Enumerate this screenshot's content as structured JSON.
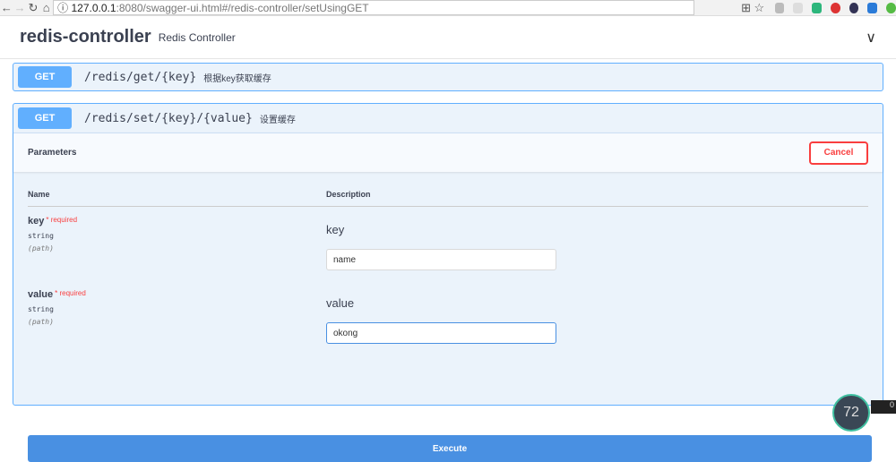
{
  "browser": {
    "url_host": "127.0.0.1",
    "url_path": ":8080/swagger-ui.html#/redis-controller/setUsingGET"
  },
  "header": {
    "title": "redis-controller",
    "description": "Redis Controller"
  },
  "ops": [
    {
      "method": "GET",
      "path": "/redis/get/{key}",
      "summary": "根据key获取缓存"
    },
    {
      "method": "GET",
      "path": "/redis/set/{key}/{value}",
      "summary": "设置缓存"
    }
  ],
  "params": {
    "title": "Parameters",
    "cancel": "Cancel",
    "col_name": "Name",
    "col_desc": "Description",
    "items": [
      {
        "name": "key",
        "required": "* required",
        "type": "string",
        "in": "(path)",
        "desc": "key",
        "value": "name"
      },
      {
        "name": "value",
        "required": "* required",
        "type": "string",
        "in": "(path)",
        "desc": "value",
        "value": "okong"
      }
    ],
    "execute": "Execute"
  },
  "overlay": {
    "gauge": "72",
    "meter": "0"
  }
}
